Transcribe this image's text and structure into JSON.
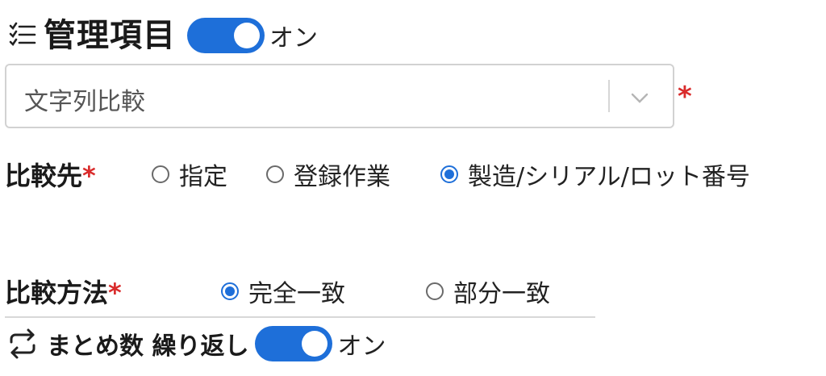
{
  "header": {
    "icon": "checklist-icon",
    "title": "管理項目",
    "toggle": {
      "state": "on",
      "label": "オン"
    }
  },
  "select": {
    "value": "文字列比較",
    "required_mark": "*",
    "icon": "chevron-down-icon"
  },
  "compare_target": {
    "label": "比較先",
    "required_mark": "*",
    "options": [
      "指定",
      "登録作業",
      "製造/シリアル/ロット番号"
    ],
    "selected_index": 2
  },
  "compare_method": {
    "label": "比較方法",
    "required_mark": "*",
    "options": [
      "完全一致",
      "部分一致"
    ],
    "selected_index": 0
  },
  "footer": {
    "icon": "repeat-icon",
    "text": "まとめ数 繰り返し",
    "toggle": {
      "state": "on",
      "label": "オン"
    }
  },
  "colors": {
    "accent": "#1e6fd9",
    "required": "#d92b2b"
  }
}
